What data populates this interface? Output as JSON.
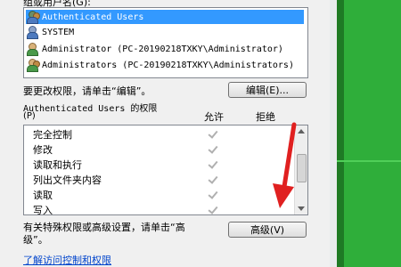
{
  "group_label_partial": "组或用户名(G):",
  "users": [
    {
      "name": "Authenticated Users",
      "icon": "group-users-icon",
      "selected": true
    },
    {
      "name": "SYSTEM",
      "icon": "system-user-icon",
      "selected": false
    },
    {
      "name": "Administrator (PC-20190218TXKY\\Administrator)",
      "icon": "user-icon",
      "selected": false
    },
    {
      "name": "Administrators (PC-20190218TXKY\\Administrators)",
      "icon": "group-users-icon",
      "selected": false
    }
  ],
  "change_permissions_text": "要更改权限，请单击“编辑”。",
  "edit_button": "编辑(E)...",
  "permissions_for_line1": "Authenticated Users 的权限",
  "permissions_for_line2": "(P)",
  "allow_header": "允许",
  "deny_header": "拒绝",
  "permissions": [
    {
      "name": "完全控制",
      "allow": true,
      "deny": false
    },
    {
      "name": "修改",
      "allow": true,
      "deny": false
    },
    {
      "name": "读取和执行",
      "allow": true,
      "deny": false
    },
    {
      "name": "列出文件夹内容",
      "allow": true,
      "deny": false
    },
    {
      "name": "读取",
      "allow": true,
      "deny": false
    },
    {
      "name": "写入",
      "allow": true,
      "deny": false
    }
  ],
  "special_text_line1": "有关特殊权限或高级设置，请单击“高",
  "special_text_line2": "级”。",
  "advanced_button": "高级(V)",
  "learn_link": "了解访问控制和权限",
  "colors": {
    "selected": "#3399ff",
    "annotation_arrow": "#e02020",
    "link": "#0044cc"
  }
}
